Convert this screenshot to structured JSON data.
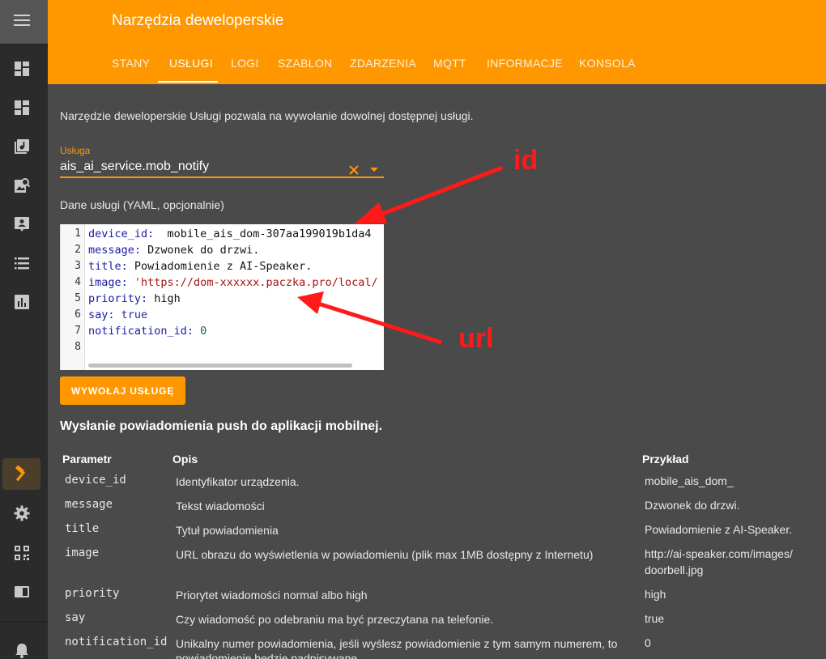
{
  "header": {
    "title": "Narzędzia deweloperskie",
    "tabs": [
      "STANY",
      "USŁUGI",
      "LOGI",
      "SZABLON",
      "ZDARZENIA",
      "MQTT",
      "INFORMACJE",
      "KONSOLA"
    ],
    "active_tab": "USŁUGI"
  },
  "sidebar": {
    "icons": [
      "menu-icon",
      "dashboard-icon",
      "dashboard-icon",
      "music-library-icon",
      "image-search-icon",
      "account-box-icon",
      "list-icon",
      "chart-icon",
      "hammer-icon",
      "gear-icon",
      "qr-code-icon",
      "book-icon",
      "bell-icon"
    ]
  },
  "main": {
    "intro": "Narzędzie deweloperskie Usługi pozwala na wywołanie dowolnej dostępnej usługi.",
    "service_label": "Usługa",
    "service_value": "ais_ai_service.mob_notify",
    "yaml_label": "Dane usługi (YAML, opcjonalnie)",
    "line_numbers": [
      "1",
      "2",
      "3",
      "4",
      "5",
      "6",
      "7",
      "8"
    ],
    "yaml": {
      "l1_key": "device_id:",
      "l1_val": "  mobile_ais_dom-307aa199019b1da4",
      "l2_key": "message:",
      "l2_val": " Dzwonek do drzwi.",
      "l3_key": "title:",
      "l3_val": " Powiadomienie z AI-Speaker.",
      "l4_key": "image:",
      "l4_val": " 'https://dom-xxxxxx.paczka.pro/local/",
      "l5_key": "priority:",
      "l5_val": " high",
      "l6_key": "say:",
      "l6_val": " true",
      "l7_key": "notification_id:",
      "l7_val": " 0"
    },
    "call_button": "WYWOŁAJ USŁUGĘ",
    "description_title": "Wysłanie powiadomienia push do aplikacji mobilnej.",
    "table": {
      "headers": [
        "Parametr",
        "Opis",
        "Przykład"
      ],
      "rows": [
        {
          "param": "device_id",
          "desc": "Identyfikator urządzenia.",
          "ex": "mobile_ais_dom_"
        },
        {
          "param": "message",
          "desc": "Tekst wiadomości",
          "ex": "Dzwonek do drzwi."
        },
        {
          "param": "title",
          "desc": "Tytuł powiadomienia",
          "ex": "Powiadomienie z AI-Speaker."
        },
        {
          "param": "image",
          "desc": "URL obrazu do wyświetlenia w powiadomieniu (plik max 1MB dostępny z Internetu)",
          "ex": "http://ai-speaker.com/images/doorbell.jpg"
        },
        {
          "param": "priority",
          "desc": "Priorytet wiadomości normal albo high",
          "ex": "high"
        },
        {
          "param": "say",
          "desc": "Czy wiadomość po odebraniu ma być przeczytana na telefonie.",
          "ex": "true"
        },
        {
          "param": "notification_id",
          "desc": "Unikalny numer powiadomienia, jeśli wyślesz powiadomienie z tym samym numerem, to powiadomienie będzie nadpisywane",
          "ex": "0"
        }
      ]
    }
  },
  "annotations": {
    "id_label": "id",
    "url_label": "url",
    "color": "#ff1a1a"
  },
  "colors": {
    "accent": "#ff9800",
    "background": "#4a4a4a",
    "sidebar": "#2b2b2b"
  }
}
